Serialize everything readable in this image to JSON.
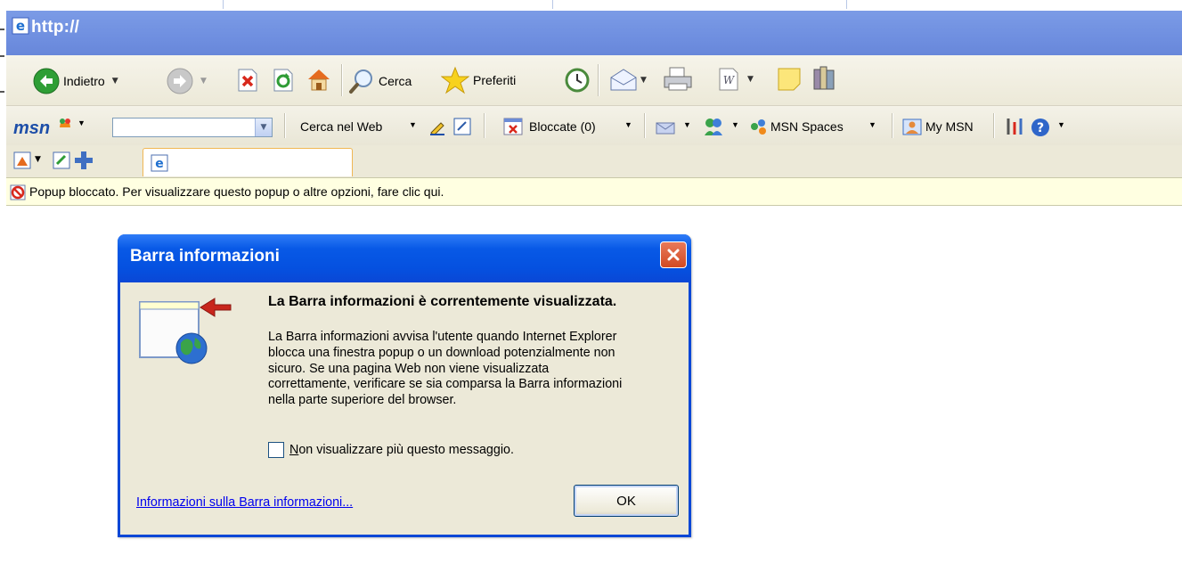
{
  "window": {
    "title": "http://"
  },
  "toolbar": {
    "back_label": "Indietro",
    "search_label": "Cerca",
    "favorites_label": "Preferiti"
  },
  "msn_toolbar": {
    "logo": "msn",
    "search_value": "",
    "web_search_label": "Cerca nel Web",
    "blocked_label": "Bloccate (0)",
    "spaces_label": "MSN Spaces",
    "my_msn_label": "My MSN"
  },
  "address": {
    "value": ""
  },
  "infobar": {
    "message": "Popup bloccato. Per visualizzare questo popup o altre opzioni, fare clic qui."
  },
  "dialog": {
    "title": "Barra informazioni",
    "heading": "La Barra informazioni è correntemente visualizzata.",
    "body_lines": [
      "La Barra informazioni avvisa l'utente quando Internet Explorer",
      "blocca una finestra popup o un download potenzialmente non",
      "sicuro. Se una pagina Web non viene visualizzata",
      "correttamente, verificare se sia comparsa la Barra informazioni",
      "nella parte superiore del browser."
    ],
    "checkbox_hotkey": "N",
    "checkbox_rest": "on visualizzare più questo messaggio.",
    "checkbox_checked": false,
    "link_text": "Informazioni sulla Barra informazioni...",
    "ok_label": "OK"
  },
  "colors": {
    "title_bar": "#6f8fe0",
    "dialog_title": "#0551e0",
    "infobar_bg": "#ffffe1",
    "close_button": "#d24a23"
  }
}
